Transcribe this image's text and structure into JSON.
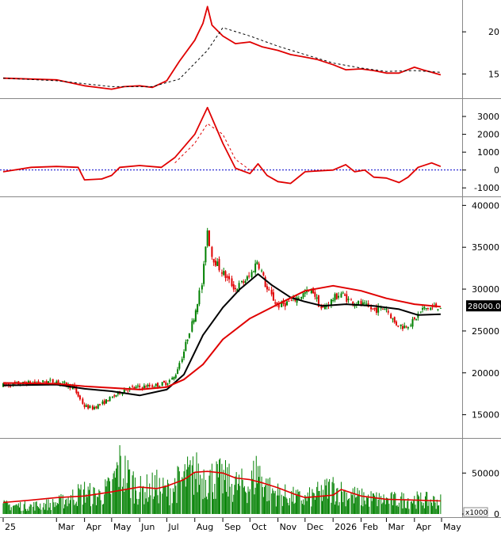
{
  "chart_data": [
    {
      "type": "line",
      "panel": "indicator-top",
      "yticks": [
        "20",
        "15"
      ],
      "ylim": [
        12.5,
        23.4
      ],
      "series": [
        {
          "color": "#e00000",
          "style": "solid",
          "x": [
            "2025-01-01",
            "2025-02-01",
            "2025-03-01",
            "2025-04-01",
            "2025-05-01",
            "2025-05-15",
            "2025-06-01",
            "2025-06-15",
            "2025-07-01",
            "2025-07-15",
            "2025-08-01",
            "2025-08-10",
            "2025-08-15",
            "2025-08-20",
            "2025-09-01",
            "2025-09-15",
            "2025-10-01",
            "2025-10-15",
            "2025-11-01",
            "2025-11-15",
            "2025-12-01",
            "2025-12-15",
            "2026-01-01",
            "2026-01-15",
            "2026-02-01",
            "2026-02-15",
            "2026-03-01",
            "2026-03-15",
            "2026-04-01",
            "2026-04-10",
            "2026-04-20",
            "2026-04-30"
          ],
          "y": [
            14.5,
            14.4,
            14.3,
            13.6,
            13.2,
            13.5,
            13.6,
            13.4,
            14.2,
            16.5,
            19.0,
            21.0,
            23.0,
            20.8,
            19.5,
            18.6,
            18.8,
            18.2,
            17.8,
            17.3,
            17.0,
            16.7,
            16.1,
            15.5,
            15.6,
            15.4,
            15.1,
            15.1,
            15.8,
            15.5,
            15.2,
            14.9
          ]
        },
        {
          "color": "#000000",
          "style": "dashed",
          "x": [
            "2025-01-01",
            "2025-03-01",
            "2025-05-01",
            "2025-06-15",
            "2025-07-15",
            "2025-08-15",
            "2025-09-01",
            "2025-10-01",
            "2025-11-01",
            "2025-12-01",
            "2026-01-01",
            "2026-02-01",
            "2026-03-01",
            "2026-04-01",
            "2026-04-30"
          ],
          "y": [
            14.5,
            14.2,
            13.5,
            13.5,
            14.4,
            17.8,
            20.5,
            19.5,
            18.3,
            17.3,
            16.3,
            15.7,
            15.3,
            15.4,
            15.2
          ]
        }
      ]
    },
    {
      "type": "line",
      "panel": "indicator-middle",
      "yticks": [
        "3000",
        "2000",
        "1000",
        "0",
        "-1000"
      ],
      "ylim": [
        -1300,
        3800
      ],
      "zero_line": true,
      "series": [
        {
          "color": "#e00000",
          "style": "solid",
          "x": [
            "2025-01-01",
            "2025-02-01",
            "2025-03-01",
            "2025-03-25",
            "2025-04-01",
            "2025-04-20",
            "2025-05-01",
            "2025-05-10",
            "2025-06-01",
            "2025-06-25",
            "2025-07-10",
            "2025-08-01",
            "2025-08-15",
            "2025-09-01",
            "2025-09-15",
            "2025-10-01",
            "2025-10-10",
            "2025-10-20",
            "2025-11-01",
            "2025-11-15",
            "2025-12-01",
            "2025-12-15",
            "2026-01-01",
            "2026-01-15",
            "2026-01-25",
            "2026-02-05",
            "2026-02-15",
            "2026-03-01",
            "2026-03-15",
            "2026-03-25",
            "2026-04-05",
            "2026-04-20",
            "2026-04-30"
          ],
          "y": [
            -100,
            150,
            200,
            150,
            -550,
            -500,
            -300,
            150,
            250,
            150,
            700,
            2000,
            3500,
            1500,
            100,
            -200,
            350,
            -300,
            -650,
            -750,
            -100,
            -50,
            0,
            300,
            -100,
            0,
            -400,
            -450,
            -700,
            -400,
            150,
            400,
            200
          ]
        },
        {
          "color": "#e00000",
          "style": "dashed",
          "x": [
            "2025-07-10",
            "2025-08-01",
            "2025-08-15",
            "2025-09-01",
            "2025-09-15",
            "2025-10-01"
          ],
          "y": [
            400,
            1500,
            2600,
            2000,
            600,
            0
          ]
        }
      ]
    },
    {
      "type": "candlestick",
      "panel": "price",
      "yticks": [
        "40000",
        "35000",
        "30000",
        "25000",
        "20000",
        "15000"
      ],
      "ylim": [
        12600,
        40600
      ],
      "last_price_label": "28000.00",
      "up_color": "#008000",
      "down_color": "#e00000",
      "price_x": [
        "2025-01-01",
        "2025-02-01",
        "2025-03-01",
        "2025-03-20",
        "2025-04-01",
        "2025-04-10",
        "2025-04-20",
        "2025-05-01",
        "2025-05-15",
        "2025-06-01",
        "2025-06-20",
        "2025-07-01",
        "2025-07-10",
        "2025-07-20",
        "2025-08-01",
        "2025-08-10",
        "2025-08-15",
        "2025-08-20",
        "2025-09-01",
        "2025-09-15",
        "2025-10-01",
        "2025-10-10",
        "2025-10-20",
        "2025-11-01",
        "2025-11-15",
        "2025-12-01",
        "2025-12-10",
        "2025-12-20",
        "2026-01-01",
        "2026-01-10",
        "2026-01-20",
        "2026-02-01",
        "2026-02-15",
        "2026-03-01",
        "2026-03-10",
        "2026-03-20",
        "2026-04-01",
        "2026-04-10",
        "2026-04-20",
        "2026-04-30"
      ],
      "price_y": [
        18500,
        18800,
        19000,
        18300,
        16000,
        15800,
        16300,
        17000,
        18000,
        18300,
        18500,
        18800,
        19500,
        22500,
        27000,
        31000,
        37500,
        34000,
        32000,
        30000,
        31500,
        33500,
        30000,
        28000,
        28500,
        29500,
        29800,
        27500,
        28800,
        29500,
        28600,
        28200,
        27500,
        27800,
        26000,
        25500,
        26200,
        27600,
        27800,
        28000
      ],
      "series": [
        {
          "name": "",
          "color": "#000000",
          "x": [
            "2025-01-01",
            "2025-03-01",
            "2025-04-01",
            "2025-05-01",
            "2025-06-01",
            "2025-07-01",
            "2025-07-20",
            "2025-08-10",
            "2025-09-01",
            "2025-09-20",
            "2025-10-10",
            "2025-10-25",
            "2025-11-15",
            "2025-12-01",
            "2025-12-20",
            "2026-01-15",
            "2026-02-15",
            "2026-03-15",
            "2026-04-05",
            "2026-04-30"
          ],
          "y": [
            18500,
            18600,
            18100,
            17800,
            17300,
            18000,
            19800,
            24500,
            27800,
            30000,
            31800,
            30500,
            29000,
            28500,
            28000,
            28200,
            28000,
            27600,
            26900,
            27000
          ]
        },
        {
          "name": "",
          "color": "#e00000",
          "x": [
            "2025-01-01",
            "2025-03-01",
            "2025-04-01",
            "2025-05-01",
            "2025-06-01",
            "2025-07-01",
            "2025-07-20",
            "2025-08-10",
            "2025-09-01",
            "2025-10-01",
            "2025-11-01",
            "2025-12-01",
            "2026-01-01",
            "2026-02-01",
            "2026-03-01",
            "2026-04-01",
            "2026-04-30"
          ],
          "y": [
            18800,
            18700,
            18400,
            18200,
            18000,
            18300,
            19200,
            21000,
            24000,
            26500,
            28200,
            29800,
            30400,
            29800,
            28900,
            28200,
            27900
          ]
        }
      ]
    },
    {
      "type": "bar",
      "panel": "volume",
      "yticks": [
        "50000",
        "0"
      ],
      "ylim": [
        0,
        88000
      ],
      "unit_label": "x1000",
      "bar_color": "#008000",
      "bar_x": [
        "2025-01-01",
        "2025-02-01",
        "2025-03-01",
        "2025-04-01",
        "2025-04-15",
        "2025-05-01",
        "2025-05-10",
        "2025-06-01",
        "2025-06-20",
        "2025-07-01",
        "2025-07-20",
        "2025-08-01",
        "2025-08-15",
        "2025-09-01",
        "2025-09-15",
        "2025-10-01",
        "2025-10-10",
        "2025-10-20",
        "2025-11-01",
        "2025-12-01",
        "2026-01-01",
        "2026-01-10",
        "2026-02-01",
        "2026-03-01",
        "2026-04-01",
        "2026-04-30"
      ],
      "bar_y": [
        15000,
        14000,
        18000,
        38000,
        30000,
        45000,
        82000,
        40000,
        48000,
        38000,
        60000,
        70000,
        62000,
        60000,
        50000,
        48000,
        78000,
        45000,
        35000,
        25000,
        45000,
        38000,
        28000,
        24000,
        25000,
        22000
      ],
      "series": [
        {
          "name": "",
          "color": "#e00000",
          "x": [
            "2025-01-01",
            "2025-02-01",
            "2025-03-01",
            "2025-04-01",
            "2025-05-01",
            "2025-06-01",
            "2025-06-20",
            "2025-07-01",
            "2025-07-20",
            "2025-08-01",
            "2025-08-15",
            "2025-09-01",
            "2025-09-15",
            "2025-10-01",
            "2025-10-15",
            "2025-11-01",
            "2025-11-20",
            "2025-12-01",
            "2026-01-01",
            "2026-01-10",
            "2026-02-01",
            "2026-03-01",
            "2026-04-01",
            "2026-04-30"
          ],
          "y": [
            14000,
            17000,
            20000,
            22000,
            27000,
            33000,
            31000,
            34000,
            42000,
            51000,
            52000,
            50000,
            44000,
            42000,
            38000,
            32000,
            24000,
            20000,
            23000,
            30000,
            22000,
            18000,
            17000,
            16000
          ]
        }
      ]
    }
  ],
  "xaxis": {
    "ticks": [
      {
        "date": "2025-01-01",
        "label": "25"
      },
      {
        "date": "2025-03-01",
        "label": "Mar"
      },
      {
        "date": "2025-04-01",
        "label": "Apr"
      },
      {
        "date": "2025-05-01",
        "label": "May"
      },
      {
        "date": "2025-06-01",
        "label": "Jun"
      },
      {
        "date": "2025-07-01",
        "label": "Jul"
      },
      {
        "date": "2025-08-01",
        "label": "Aug"
      },
      {
        "date": "2025-09-01",
        "label": "Sep"
      },
      {
        "date": "2025-10-01",
        "label": "Oct"
      },
      {
        "date": "2025-11-01",
        "label": "Nov"
      },
      {
        "date": "2025-12-01",
        "label": "Dec"
      },
      {
        "date": "2026-01-01",
        "label": "2026"
      },
      {
        "date": "2026-02-01",
        "label": "Feb"
      },
      {
        "date": "2026-03-01",
        "label": "Mar"
      },
      {
        "date": "2026-04-01",
        "label": "Apr"
      },
      {
        "date": "2026-05-01",
        "label": "May"
      }
    ]
  }
}
